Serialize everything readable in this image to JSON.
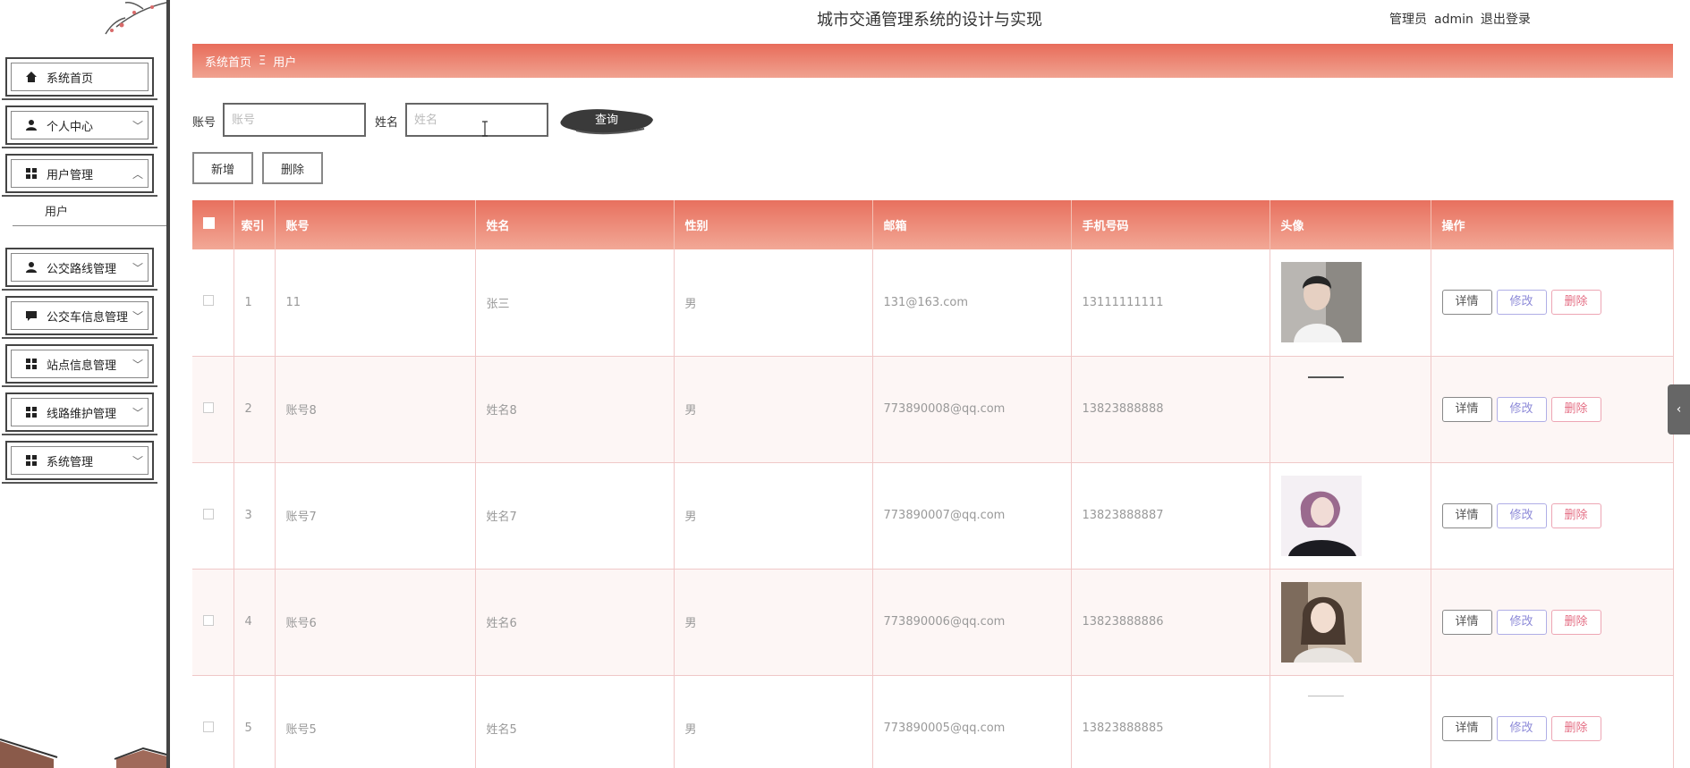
{
  "header": {
    "title": "城市交通管理系统的设计与实现",
    "role": "管理员",
    "username": "admin",
    "logout": "退出登录"
  },
  "sidebar": {
    "items": [
      {
        "label": "系统首页",
        "icon": "home-icon"
      },
      {
        "label": "个人中心",
        "icon": "user-icon"
      },
      {
        "label": "用户管理",
        "icon": "grid-icon"
      },
      {
        "label": "公交路线管理",
        "icon": "user-icon"
      },
      {
        "label": "公交车信息管理",
        "icon": "chat-icon"
      },
      {
        "label": "站点信息管理",
        "icon": "grid-icon"
      },
      {
        "label": "线路维护管理",
        "icon": "grid-icon"
      },
      {
        "label": "系统管理",
        "icon": "grid-icon"
      }
    ],
    "sub_item": "用户"
  },
  "breadcrumb": {
    "home": "系统首页",
    "sep": "Ξ",
    "current": "用户"
  },
  "search": {
    "account_label": "账号",
    "account_placeholder": "账号",
    "name_label": "姓名",
    "name_placeholder": "姓名",
    "query_button": "查询"
  },
  "actions": {
    "add": "新增",
    "delete": "删除"
  },
  "table": {
    "headers": [
      "索引",
      "账号",
      "姓名",
      "性别",
      "邮箱",
      "手机号码",
      "头像",
      "操作"
    ],
    "rows": [
      {
        "index": "1",
        "account": "11",
        "name": "张三",
        "gender": "男",
        "email": "131@163.com",
        "phone": "13111111111",
        "avatar": "man"
      },
      {
        "index": "2",
        "account": "账号8",
        "name": "姓名8",
        "gender": "男",
        "email": "773890008@qq.com",
        "phone": "13823888888",
        "avatar": "none"
      },
      {
        "index": "3",
        "account": "账号7",
        "name": "姓名7",
        "gender": "男",
        "email": "773890007@qq.com",
        "phone": "13823888887",
        "avatar": "woman1"
      },
      {
        "index": "4",
        "account": "账号6",
        "name": "姓名6",
        "gender": "男",
        "email": "773890006@qq.com",
        "phone": "13823888886",
        "avatar": "woman2"
      },
      {
        "index": "5",
        "account": "账号5",
        "name": "姓名5",
        "gender": "男",
        "email": "773890005@qq.com",
        "phone": "13823888885",
        "avatar": "none"
      }
    ],
    "row_buttons": {
      "detail": "详情",
      "edit": "修改",
      "delete": "删除"
    }
  },
  "colors": {
    "accent": "#e86c5a",
    "accent_light": "#f2a896",
    "row_alt": "#fdf6f5"
  }
}
